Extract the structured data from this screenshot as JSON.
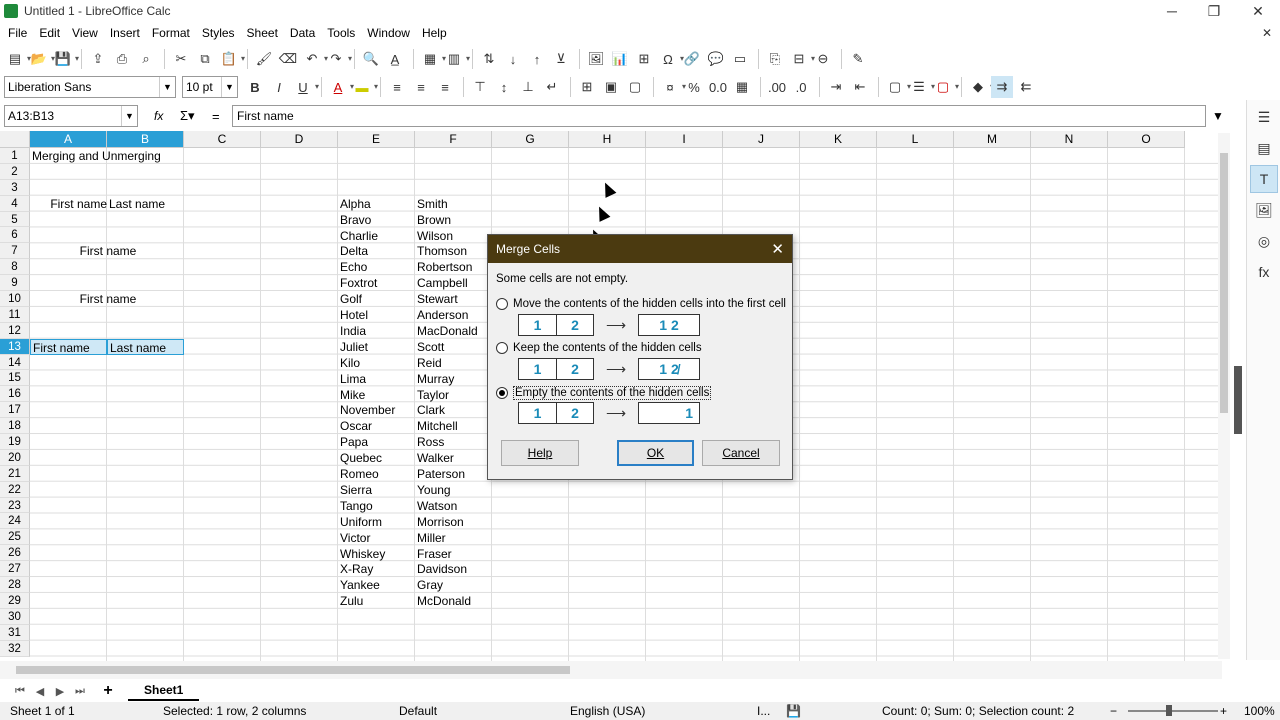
{
  "window": {
    "title": "Untitled 1 - LibreOffice Calc",
    "minimize": "─",
    "restore": "❐",
    "close": "✕"
  },
  "menu": [
    "File",
    "Edit",
    "View",
    "Insert",
    "Format",
    "Styles",
    "Sheet",
    "Data",
    "Tools",
    "Window",
    "Help"
  ],
  "font": {
    "name": "Liberation Sans",
    "size": "10 pt"
  },
  "formula": {
    "namebox": "A13:B13",
    "content": "First name"
  },
  "columns": [
    "A",
    "B",
    "C",
    "D",
    "E",
    "F",
    "G",
    "H",
    "I",
    "J",
    "K",
    "L",
    "M",
    "N",
    "O"
  ],
  "rows": [
    "1",
    "2",
    "3",
    "4",
    "5",
    "6",
    "7",
    "8",
    "9",
    "10",
    "11",
    "12",
    "13",
    "14",
    "15",
    "16",
    "17",
    "18",
    "19",
    "20",
    "21",
    "22",
    "23",
    "24",
    "25",
    "26",
    "27",
    "28",
    "29",
    "30",
    "31",
    "32"
  ],
  "cells": {
    "title": "Merging and Unmerging",
    "a4": "First name",
    "b4": "Last name",
    "ab7": "First name",
    "ab10": "First name",
    "a13": "First name",
    "b13": "Last name",
    "colE": [
      "Alpha",
      "Bravo",
      "Charlie",
      "Delta",
      "Echo",
      "Foxtrot",
      "Golf",
      "Hotel",
      "India",
      "Juliet",
      "Kilo",
      "Lima",
      "Mike",
      "November",
      "Oscar",
      "Papa",
      "Quebec",
      "Romeo",
      "Sierra",
      "Tango",
      "Uniform",
      "Victor",
      "Whiskey",
      "X-Ray",
      "Yankee",
      "Zulu"
    ],
    "colF": [
      "Smith",
      "Brown",
      "Wilson",
      "Thomson",
      "Robertson",
      "Campbell",
      "Stewart",
      "Anderson",
      "MacDonald",
      "Scott",
      "Reid",
      "Murray",
      "Taylor",
      "Clark",
      "Mitchell",
      "Ross",
      "Walker",
      "Paterson",
      "Young",
      "Watson",
      "Morrison",
      "Miller",
      "Fraser",
      "Davidson",
      "Gray",
      "McDonald"
    ]
  },
  "dialog": {
    "title": "Merge Cells",
    "message": "Some cells are not empty.",
    "opt1": "Move the contents of the hidden cells into the first cell",
    "opt2": "Keep the contents of the hidden cells",
    "opt3": "Empty the contents of the hidden cells",
    "d1": "1",
    "d2": "2",
    "arrow": "⟶",
    "r1": "1 2",
    "r2": "1 2̸",
    "r3": "1",
    "help": "Help",
    "ok": "OK",
    "cancel": "Cancel"
  },
  "tabs": {
    "sheet": "Sheet1"
  },
  "status": {
    "sheet": "Sheet 1 of 1",
    "selection": "Selected: 1 row, 2 columns",
    "style": "Default",
    "lang": "English (USA)",
    "ins": "I...",
    "sum": "Count: 0; Sum: 0; Selection count: 2",
    "zoom": "100%"
  }
}
